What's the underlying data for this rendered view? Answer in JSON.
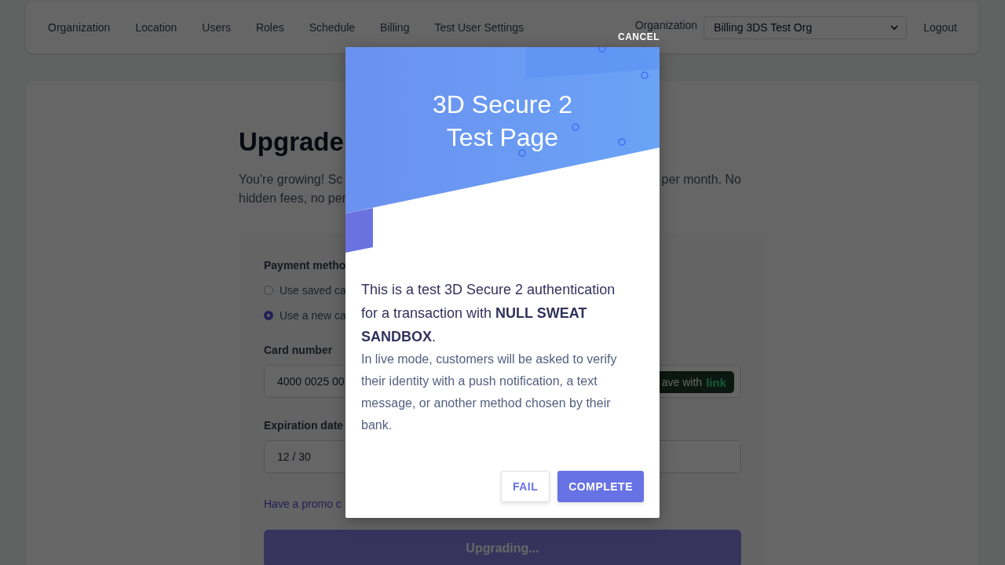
{
  "nav": {
    "items": [
      "Organization",
      "Location",
      "Users",
      "Roles",
      "Schedule",
      "Billing",
      "Test User Settings"
    ],
    "organization_label": "Organization",
    "organization_select": {
      "value": "Billing 3DS Test Org"
    },
    "logout": "Logout"
  },
  "page": {
    "heading": "Upgrade",
    "intro_lines": [
      {
        "left": "You're growing! Sc",
        "right": "per month. No"
      },
      {
        "left": "hidden fees, no per"
      }
    ]
  },
  "form": {
    "payment_method_label": "Payment metho",
    "payment_options": [
      {
        "label": "Use saved ca",
        "selected": false
      },
      {
        "label": "Use a new ca",
        "selected": true
      }
    ],
    "card_number": {
      "label": "Card number",
      "value": "4000 0025 00",
      "link_button": {
        "text": "ave with",
        "brand": "link"
      }
    },
    "expiration": {
      "label": "Expiration date",
      "value": "12 / 30"
    },
    "promo_link": "Have a promo c",
    "submit": {
      "label": "Upgrading...",
      "disabled": true
    }
  },
  "modal": {
    "cancel": "CANCEL",
    "title_lines": [
      "3D Secure 2",
      "Test Page"
    ],
    "message": "This is a test 3D Secure 2 authentication for a transaction with **NULL SWEAT SANDBOX**.",
    "detail": "In live mode, customers will be asked to verify their identity with a push notification, a text message, or another method chosen by their bank.",
    "buttons": [
      {
        "label": "FAIL",
        "kind": "secondary"
      },
      {
        "label": "COMPLETE",
        "kind": "primary"
      }
    ]
  }
}
